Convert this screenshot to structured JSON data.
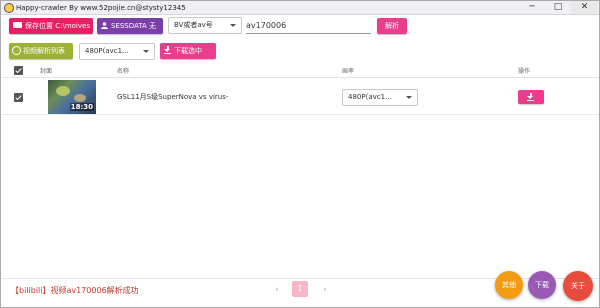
{
  "window": {
    "title": "Happy-crawler By www.52pojie.cn@stysty12345",
    "minimize": "─",
    "maximize": "□",
    "close": "✕"
  },
  "toolbar": {
    "save_location_label": "保存位置 C:\\moives",
    "sessdata_label": "SESSDATA 无",
    "id_type_selected": "BV或者av号",
    "url_input_value": "av170006",
    "parse_label": "解析",
    "parse_list_label": "视频解析列表",
    "quality_selected": "480P(avc1...",
    "download_selected_label": "下载选中"
  },
  "table": {
    "headers": {
      "cover": "封面",
      "name": "名称",
      "quality": "画率",
      "action": "操作"
    },
    "rows": [
      {
        "checked": true,
        "duration": "18:30",
        "name": "GSL11月S级SuperNova vs virus-",
        "quality": "480P(avc1..."
      }
    ]
  },
  "footer": {
    "status": "【bilibili】视频av170006解析成功",
    "pagination": {
      "prev": "‹",
      "current": "1",
      "next": "›"
    },
    "fab_reward": "其他",
    "fab_download": "下载",
    "fab_about": "关于"
  },
  "colors": {
    "save_button": "#e91e63",
    "sessdata_button": "#7b3fa8",
    "accent_pink": "#e83e8c",
    "list_button": "#9db237",
    "status_text": "#c0392b"
  },
  "icons": [
    "app-icon",
    "tag-icon",
    "person-icon",
    "play-icon",
    "download-icon",
    "chevron-down-icon",
    "checkbox-icon"
  ]
}
